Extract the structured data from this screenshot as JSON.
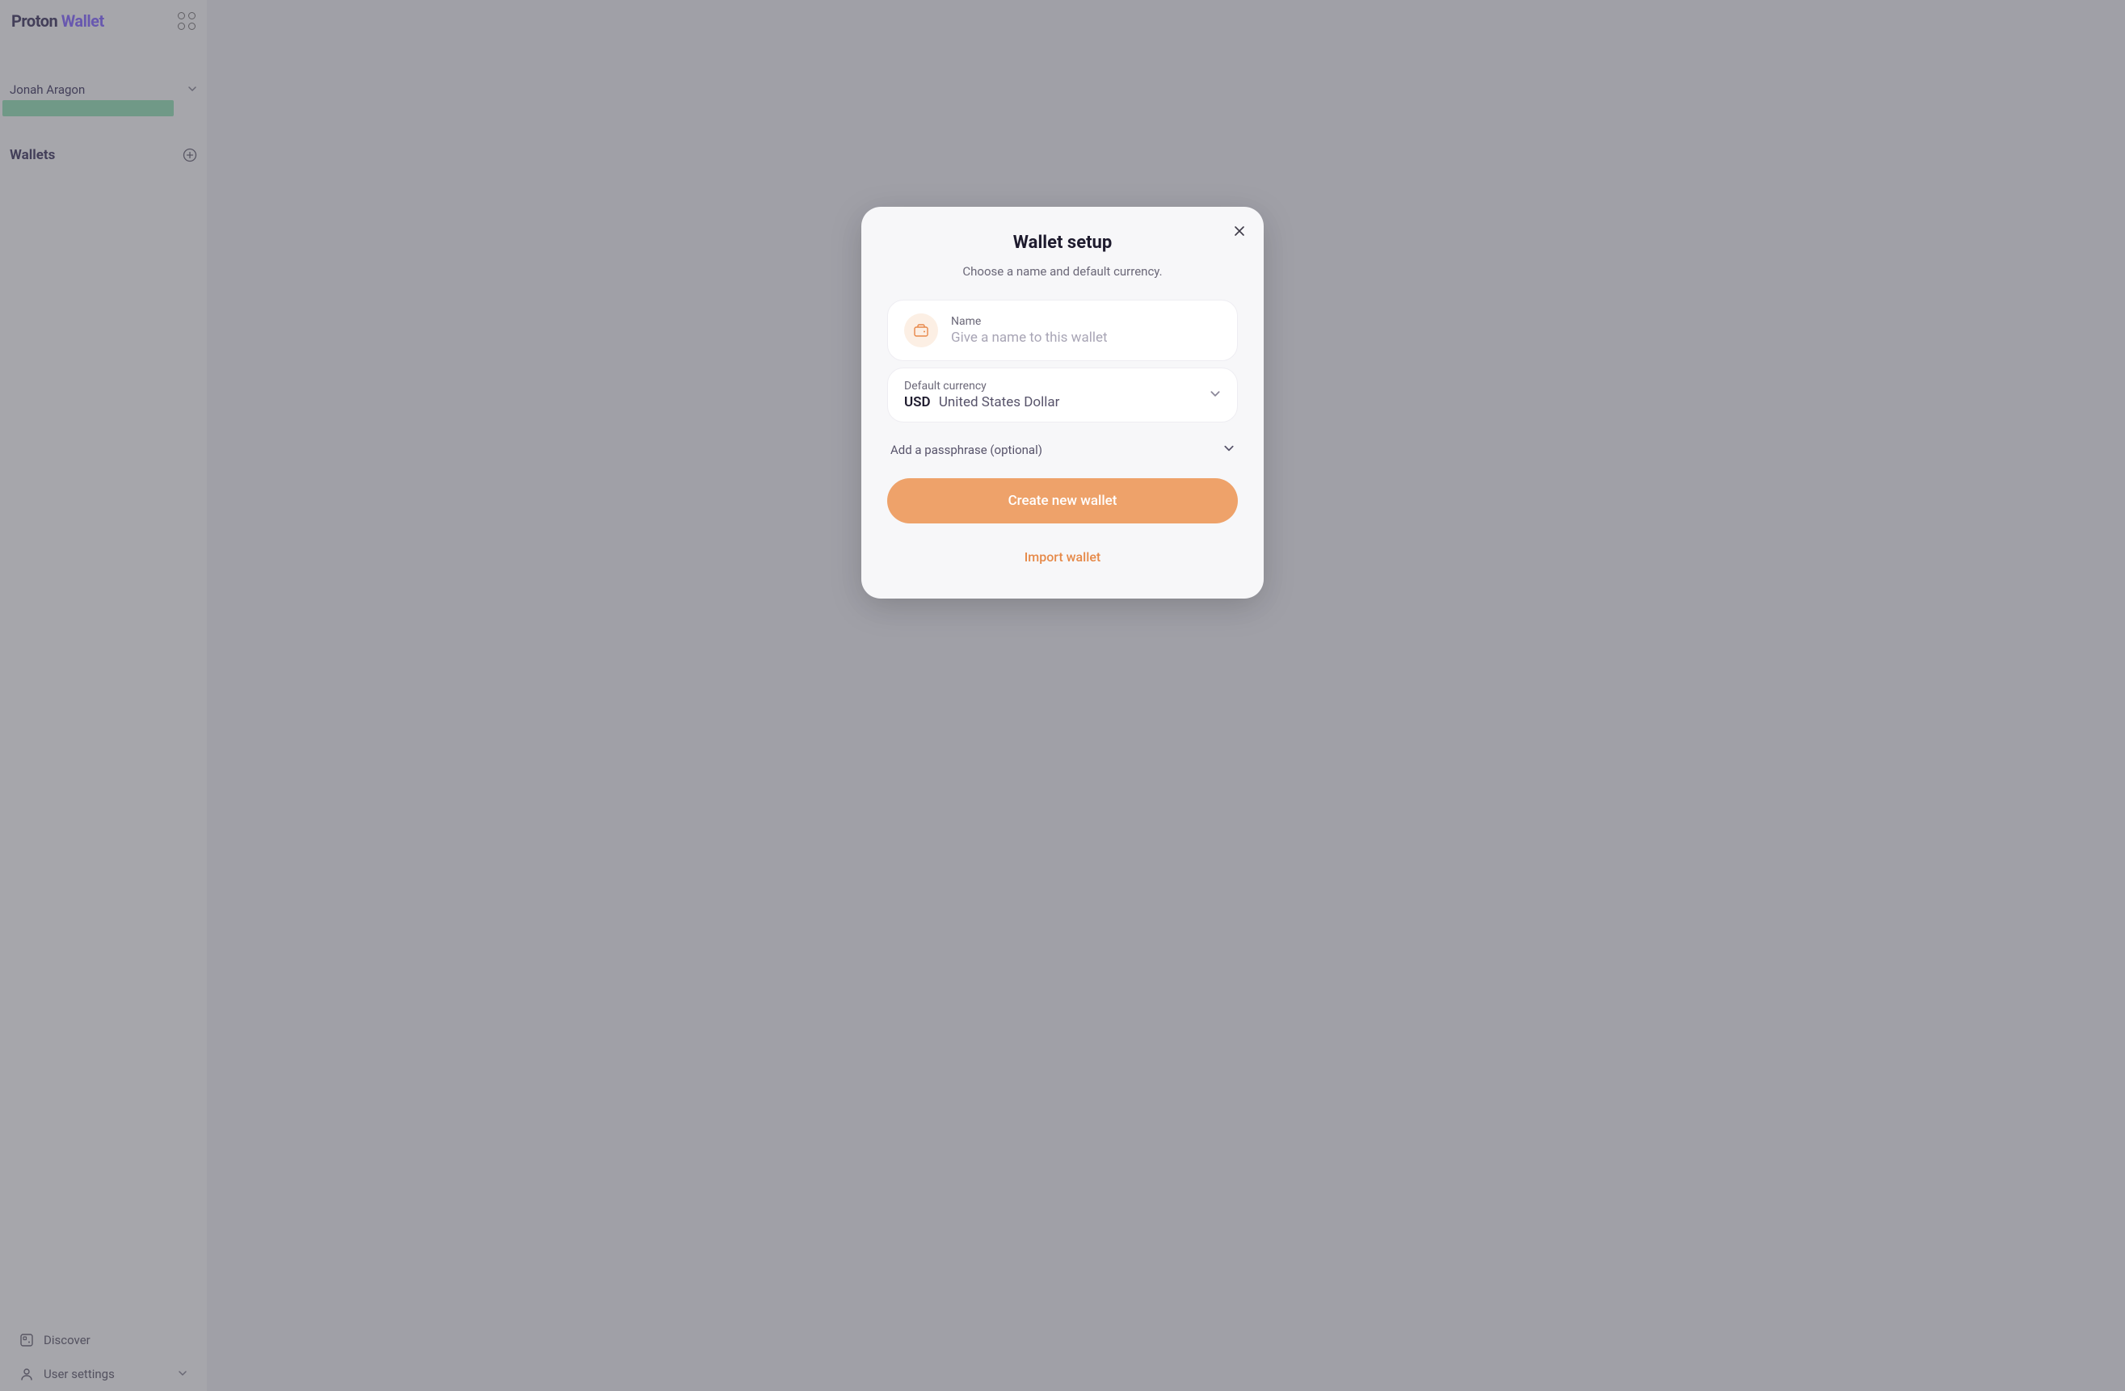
{
  "brand": {
    "part1": "Proton",
    "part2": "Wallet"
  },
  "user": {
    "name": "Jonah Aragon"
  },
  "sidebar": {
    "wallets_label": "Wallets",
    "discover_label": "Discover",
    "user_settings_label": "User settings"
  },
  "modal": {
    "title": "Wallet setup",
    "subtitle": "Choose a name and default currency.",
    "name_label": "Name",
    "name_placeholder": "Give a name to this wallet",
    "currency_label": "Default currency",
    "currency_code": "USD",
    "currency_name": "United States Dollar",
    "passphrase_label": "Add a passphrase (optional)",
    "create_button": "Create new wallet",
    "import_button": "Import wallet"
  }
}
